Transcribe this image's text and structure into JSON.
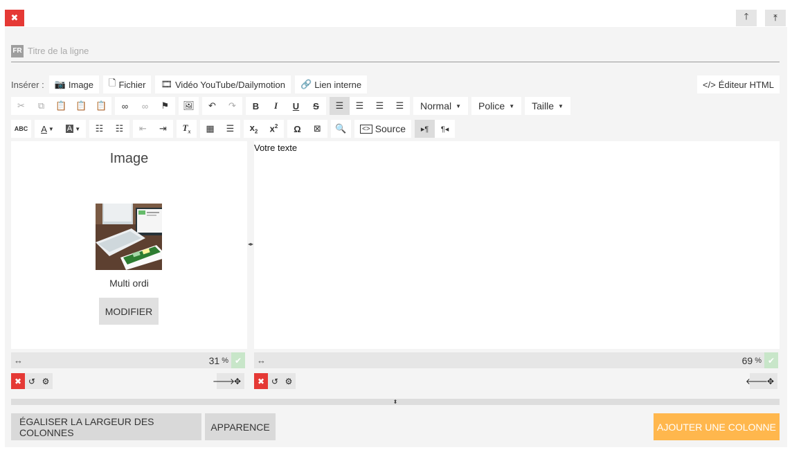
{
  "row": {
    "lang_badge": "FR",
    "title_placeholder": "Titre de la ligne"
  },
  "insert": {
    "label": "Insérer :",
    "image": "Image",
    "file": "Fichier",
    "video": "Vidéo YouTube/Dailymotion",
    "internal_link": "Lien interne",
    "html_editor": "Éditeur HTML"
  },
  "toolbar": {
    "format": "Normal",
    "font": "Police",
    "size": "Taille",
    "source": "Source"
  },
  "left_column": {
    "title": "Image",
    "caption": "Multi ordi",
    "modify": "MODIFIER",
    "width_value": "31",
    "width_unit": "%"
  },
  "right_column": {
    "text": "Votre texte",
    "width_value": "69",
    "width_unit": "%"
  },
  "footer": {
    "equalize": "ÉGALISER LA LARGEUR DES COLONNES",
    "appearance": "APPARENCE",
    "add_column": "AJOUTER UNE COLONNE"
  },
  "colors": {
    "danger": "#e53935",
    "accent": "#ffb74d",
    "success_light": "#c8e6c9"
  }
}
